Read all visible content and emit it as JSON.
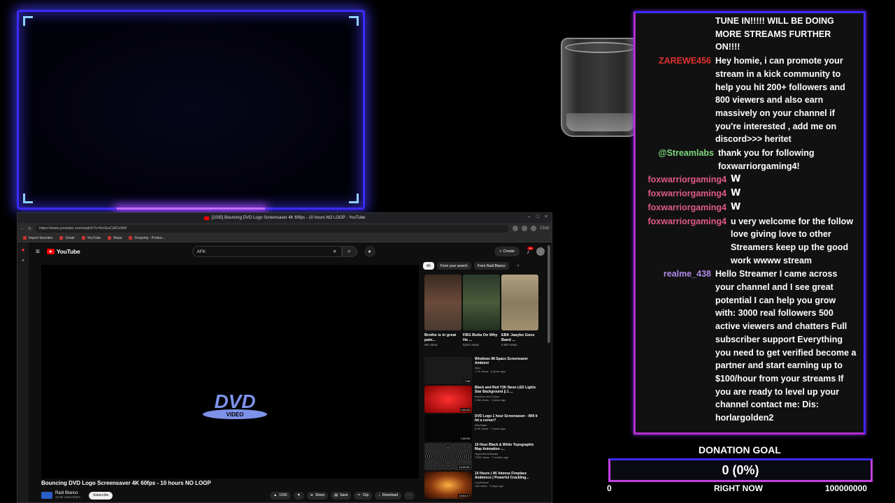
{
  "browser": {
    "tab_title": "[1035] Bouncing DVD Logo Screensaver 4K 60fps - 10 hours NO LOOP - YouTube",
    "url": "https://www.youtube.com/watch?v=5mGuCdICsNM",
    "bookmarks": [
      "Import favorites",
      "Gmail",
      "YouTube",
      "Maps",
      "Dropship - Produc..."
    ],
    "profile_label": "Chat"
  },
  "youtube": {
    "logo": "YouTube",
    "search_value": "AFK",
    "create_label": "Create",
    "notif_count": "9+",
    "dvd_text": "DVD",
    "dvd_sub": "VIDEO",
    "video_title": "Bouncing DVD Logo Screensaver 4K 60fps - 10 hours NO LOOP",
    "channel_name": "Raúl Blanco",
    "channel_subs": "12.8K subscribers",
    "subscribe_label": "Subscribe",
    "like_count": "131K",
    "share_label": "Share",
    "save_label": "Save",
    "clip_label": "Clip",
    "download_label": "Download",
    "chips": [
      "All",
      "From your search",
      "From Raúl Blanco"
    ],
    "shorts": [
      {
        "title": "Brothe is in great pain...",
        "views": "9M views",
        "color": "#6b4a3a"
      },
      {
        "title": "FBG Butta On Why He ...",
        "views": "522K views",
        "color": "#3a4a3a"
      },
      {
        "title": "EBK Jaaybo Goes Band ...",
        "views": "9.9M views",
        "color": "#9a8a70"
      }
    ],
    "recs": [
      {
        "title": "Windows 98 Space Screensaver Ambient",
        "channel": "Illoto",
        "meta": "1.7K views · 6 years ago",
        "dur": "7:58",
        "color": "#1a1a1a"
      },
      {
        "title": "Black and Red Y2K Neon LED Lights Star Background || 1 ...",
        "channel": "Bradens and Colour",
        "meta": "2.9M views · 3 years ago",
        "dur": "1:00:25",
        "color": "#a01010"
      },
      {
        "title": "DVD Logo 1 hour Screensaver - Will it hit a corner?",
        "channel": "EllioFlake",
        "meta": "8.3K views · 7 years ago",
        "dur": "1:00:00",
        "color": "#050505"
      },
      {
        "title": "10 Hour Black & White Topographic Map Animation -...",
        "channel": "HypnoKimsVisuals",
        "meta": "733K views · 7 months ago",
        "dur": "10:20:51",
        "color": "#2a2a2a"
      },
      {
        "title": "10 Hours | 4K Intense Fireplace Ambience | Powerful Crackling...",
        "channel": "LuniSolace",
        "meta": "145 views · 3 days ago",
        "dur": "10:01:17",
        "color": "#8a3a10"
      }
    ]
  },
  "chat": {
    "messages": [
      {
        "user": "",
        "user_color": "#ffffff",
        "text": "TUNE IN!!!!! WILL BE DOING MORE STREAMS FURTHER ON!!!!"
      },
      {
        "user": "ZAREWE456",
        "user_color": "#e03030",
        "text": "Hey homie, i can promote your stream in a kick community to help you hit 200+ followers and 800 viewers and also earn massively on your channel if you're interested , add me on discord>>> heritet"
      },
      {
        "user": "@Streamlabs",
        "user_color": "#7ed87e",
        "text": "thank you for following foxwarriorgaming4!"
      },
      {
        "user": "foxwarriorgaming4",
        "user_color": "#e05a8a",
        "text": "W",
        "badge": true
      },
      {
        "user": "foxwarriorgaming4",
        "user_color": "#e05a8a",
        "text": "W",
        "badge": true
      },
      {
        "user": "foxwarriorgaming4",
        "user_color": "#e05a8a",
        "text": "W",
        "badge": true
      },
      {
        "user": "foxwarriorgaming4",
        "user_color": "#e05a8a",
        "text": "u very welcome for the follow love giving love to other Streamers keep up the good work wwww stream"
      },
      {
        "user": "realme_438",
        "user_color": "#b08ae8",
        "text": "Hello Streamer I came across your channel and I see great potential I can help you grow with: 3000 real followers 500 active viewers and chatters Full subscriber support Everything you need to get verified become a partner and start earning up to $100/hour from your streams If you are ready to level up your channel contact me: Dis: horlargolden2"
      }
    ]
  },
  "donation": {
    "title": "DONATION GOAL",
    "progress": "0 (0%)",
    "fraction": 0,
    "min": "0",
    "label": "RIGHT NOW",
    "max": "100000000"
  },
  "colors": {
    "neon_blue": "#3b2bff",
    "neon_purple": "#b32fd0",
    "yt_red": "#ff0000"
  }
}
